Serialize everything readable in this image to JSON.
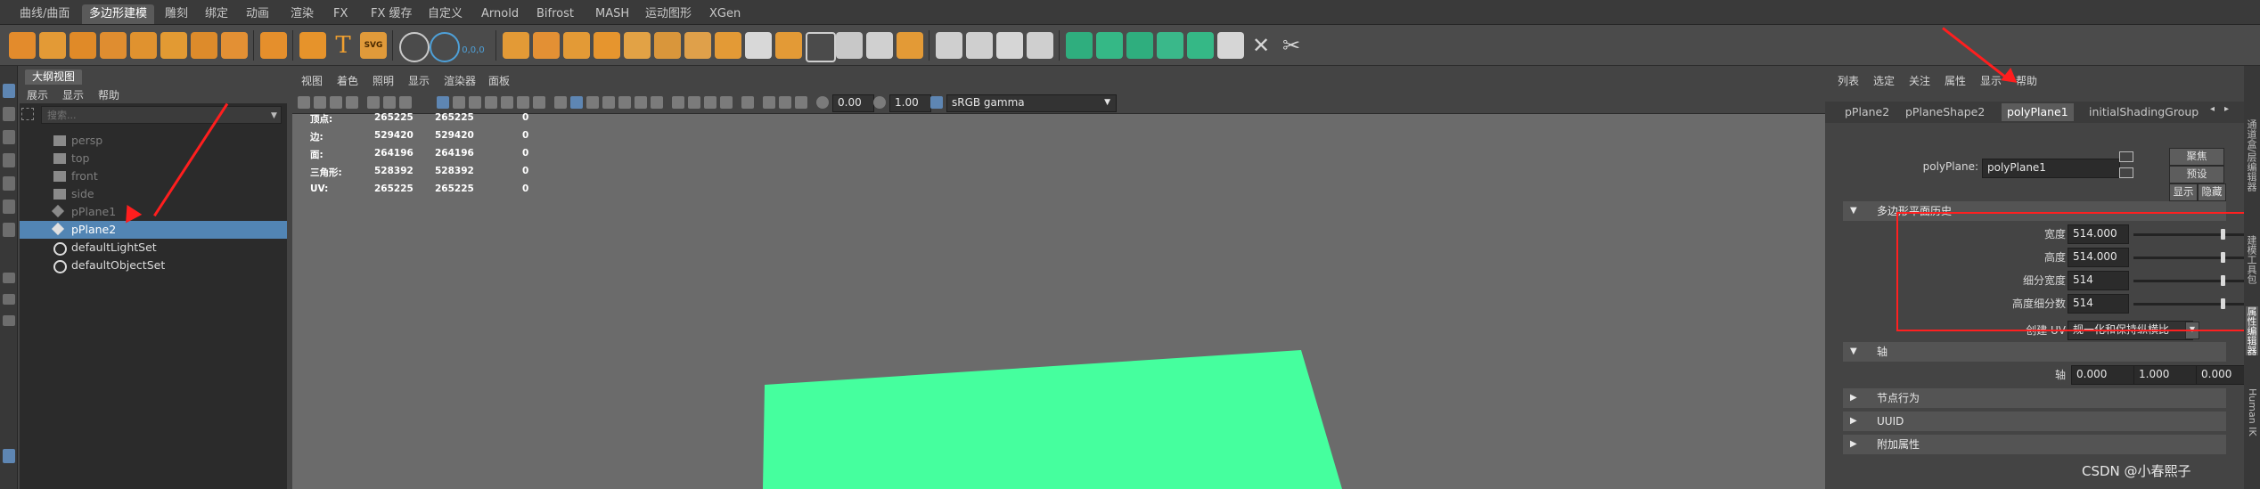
{
  "shelf_tabs": [
    "曲线/曲面",
    "多边形建模",
    "雕刻",
    "绑定",
    "动画",
    "渲染",
    "FX",
    "FX 缓存",
    "自定义",
    "Arnold",
    "Bifrost",
    "MASH",
    "运动图形",
    "XGen"
  ],
  "shelf_active_tab": 1,
  "shelf_icon_labels": {
    "text_tool": "T",
    "svg_tool": "SVG",
    "coord_readout": "0,0,0"
  },
  "outliner": {
    "title": "大纲视图",
    "menu": [
      "展示",
      "显示",
      "帮助"
    ],
    "search_placeholder": "搜索...",
    "items": [
      {
        "label": "persp",
        "type": "camera",
        "dim": true,
        "selected": false
      },
      {
        "label": "top",
        "type": "camera",
        "dim": true,
        "selected": false
      },
      {
        "label": "front",
        "type": "camera",
        "dim": true,
        "selected": false
      },
      {
        "label": "side",
        "type": "camera",
        "dim": true,
        "selected": false
      },
      {
        "label": "pPlane1",
        "type": "mesh",
        "dim": true,
        "selected": false
      },
      {
        "label": "pPlane2",
        "type": "mesh",
        "dim": false,
        "selected": true
      },
      {
        "label": "defaultLightSet",
        "type": "set",
        "dim": false,
        "selected": false
      },
      {
        "label": "defaultObjectSet",
        "type": "set",
        "dim": false,
        "selected": false
      }
    ]
  },
  "viewport": {
    "menu": [
      "视图",
      "着色",
      "照明",
      "显示",
      "渲染器",
      "面板"
    ],
    "exposure": "0.00",
    "gamma": "1.00",
    "colorspace": "sRGB gamma",
    "hud": [
      {
        "label": "顶点:",
        "v1": "265225",
        "v2": "265225",
        "v3": "0"
      },
      {
        "label": "边:",
        "v1": "529420",
        "v2": "529420",
        "v3": "0"
      },
      {
        "label": "面:",
        "v1": "264196",
        "v2": "264196",
        "v3": "0"
      },
      {
        "label": "三角形:",
        "v1": "528392",
        "v2": "528392",
        "v3": "0"
      },
      {
        "label": "UV:",
        "v1": "265225",
        "v2": "265225",
        "v3": "0"
      }
    ],
    "plane_color": "#45ff9e",
    "viewport_bg": "#6b6b6b"
  },
  "attribute_editor": {
    "menu": [
      "列表",
      "选定",
      "关注",
      "属性",
      "显示",
      "帮助"
    ],
    "tabs": [
      "pPlane2",
      "pPlaneShape2",
      "polyPlane1",
      "initialShadingGroup"
    ],
    "active_tab": 2,
    "node_label": "polyPlane:",
    "node_name": "polyPlane1",
    "buttons": {
      "focus": "聚焦",
      "presets": "预设",
      "show": "显示",
      "hide": "隐藏"
    },
    "history_section": "多边形平面历史",
    "fields": [
      {
        "label": "宽度",
        "value": "514.000",
        "slider_fraction": 0.5
      },
      {
        "label": "高度",
        "value": "514.000",
        "slider_fraction": 0.5
      },
      {
        "label": "细分宽度",
        "value": "514",
        "slider_fraction": 0.5
      },
      {
        "label": "高度细分数",
        "value": "514",
        "slider_fraction": 0.5
      }
    ],
    "create_uv_label": "创建 UV",
    "create_uv_value": "规一化和保持纵横比",
    "axis_section": "轴",
    "axis_label": "轴",
    "axis_values": [
      "0.000",
      "1.000",
      "0.000"
    ],
    "collapsed_sections": [
      "节点行为",
      "UUID",
      "附加属性"
    ]
  },
  "right_vertical_tabs": [
    "通道盒/层编辑器",
    "建模工具包",
    "属性编辑器",
    "Human IK"
  ],
  "watermark": "CSDN @小春熙子",
  "annotation_color": "#ff2020"
}
